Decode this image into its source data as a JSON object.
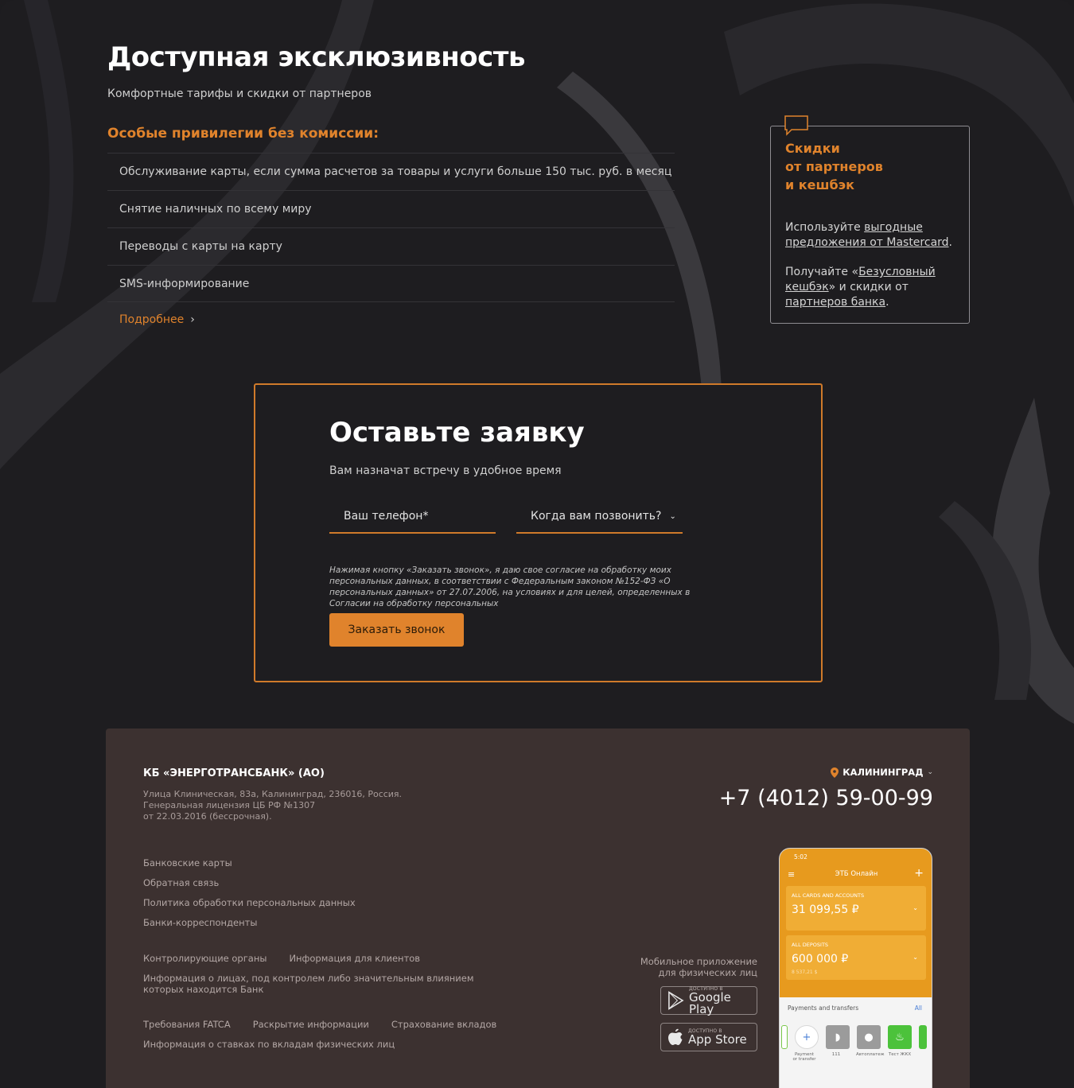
{
  "hero": {
    "title": "Доступная эксклюзивность",
    "subtitle": "Комфортные тарифы и скидки от партнеров",
    "privileges_title": "Особые привилегии без комиссии:",
    "privileges": [
      "Обслуживание карты, если сумма расчетов за товары и услуги больше 150 тыс. руб. в месяц",
      "Снятие наличных по всему миру",
      "Переводы с карты на карту",
      "SMS-информирование"
    ],
    "more_label": "Подробнее",
    "more_icon": "chevron-right-icon"
  },
  "promo_card": {
    "icon": "speech-bubble-icon",
    "title": "Скидки\nот партнеров\nи кешбэк",
    "p1_prefix": "Используйте ",
    "p1_link": "выгодные предложения от Mastercard",
    "p1_suffix": ".",
    "p2_prefix": "Получайте «",
    "p2_link1": "Безусловный кешбэк",
    "p2_mid": "» и скидки от ",
    "p2_link2": "партнеров банка",
    "p2_suffix": "."
  },
  "request_form": {
    "title": "Оставьте заявку",
    "subtitle": "Вам назначат встречу в удобное время",
    "phone_placeholder": "Ваш телефон*",
    "when_placeholder": "Когда вам позвонить?",
    "when_icon": "chevron-down-icon",
    "consent": "Нажимая кнопку «Заказать звонок», я даю свое согласие на обработку моих персональных данных, в соответствии с Федеральным законом №152-ФЗ «О персональных данных» от 27.07.2006, на условиях и для целей, определенных в Согласии на обработку персональных",
    "submit_label": "Заказать звонок"
  },
  "footer": {
    "bank_name": "КБ «ЭНЕРГОТРАНСБАНК» (АО)",
    "address": "Улица Клиническая, 83а, Калининград, 236016, Россия.\nГенеральная лицензия ЦБ РФ №1307\nот 22.03.2016 (бессрочная).",
    "links_group1": [
      "Банковские карты",
      "Обратная связь",
      "Политика обработки персональных данных",
      "Банки-корреспонденты"
    ],
    "links_group2_row": [
      "Контролирующие органы",
      "Информация для клиентов"
    ],
    "links_group2_extra": "Информация о лицах, под контролем либо значительным влиянием которых находится Банк",
    "links_group3_row": [
      "Требования FATCA",
      "Раскрытие информации",
      "Страхование вкладов"
    ],
    "links_group3_extra": "Информация о ставках по вкладам физических лиц",
    "city": "КАЛИНИНГРАД",
    "city_icon": "location-pin-icon",
    "phone": "+7 (4012) 59-00-99",
    "app_note": "Мобильное приложение\nдля физических лиц",
    "google_play_small": "ДОСТУПНО В",
    "google_play_big": "Google Play",
    "app_store_small": "ДОСТУПНО В",
    "app_store_big": "App Store"
  },
  "phone_mockup": {
    "time": "5:02",
    "header": "ЭТБ Онлайн",
    "card1_label": "ALL CARDS AND ACCOUNTS",
    "card1_value": "31 099,55 ₽",
    "card2_label": "ALL DEPOSITS",
    "card2_value": "600 000 ₽",
    "card2_small": "8 537,21 $",
    "payments_label": "Payments and transfers",
    "all_label": "All",
    "tile_labels": [
      "Payment or transfer",
      "111",
      "Автоплатеж",
      "Тест ЖКХ"
    ]
  },
  "colors": {
    "accent": "#e0832c",
    "background": "#1e1d20",
    "footer_bg": "#3c3130",
    "app_orange": "#e79a1e"
  }
}
